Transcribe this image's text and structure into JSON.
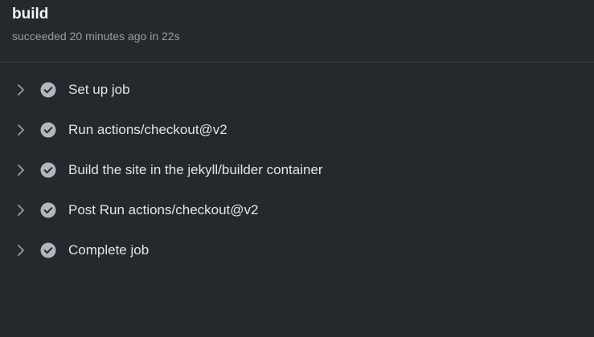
{
  "job": {
    "title": "build",
    "status": "succeeded 20 minutes ago in 22s"
  },
  "steps": [
    {
      "label": "Set up job",
      "status_icon": "check-circle-icon",
      "expand_icon": "chevron-right-icon"
    },
    {
      "label": "Run actions/checkout@v2",
      "status_icon": "check-circle-icon",
      "expand_icon": "chevron-right-icon"
    },
    {
      "label": "Build the site in the jekyll/builder container",
      "status_icon": "check-circle-icon",
      "expand_icon": "chevron-right-icon"
    },
    {
      "label": "Post Run actions/checkout@v2",
      "status_icon": "check-circle-icon",
      "expand_icon": "chevron-right-icon"
    },
    {
      "label": "Complete job",
      "status_icon": "check-circle-icon",
      "expand_icon": "chevron-right-icon"
    }
  ],
  "colors": {
    "background": "#24292e",
    "title": "#f0f6fc",
    "subtitle": "#959da5",
    "step_text": "#e1e4e8",
    "check_fill": "#b1b7bf",
    "chevron": "#959da5"
  }
}
